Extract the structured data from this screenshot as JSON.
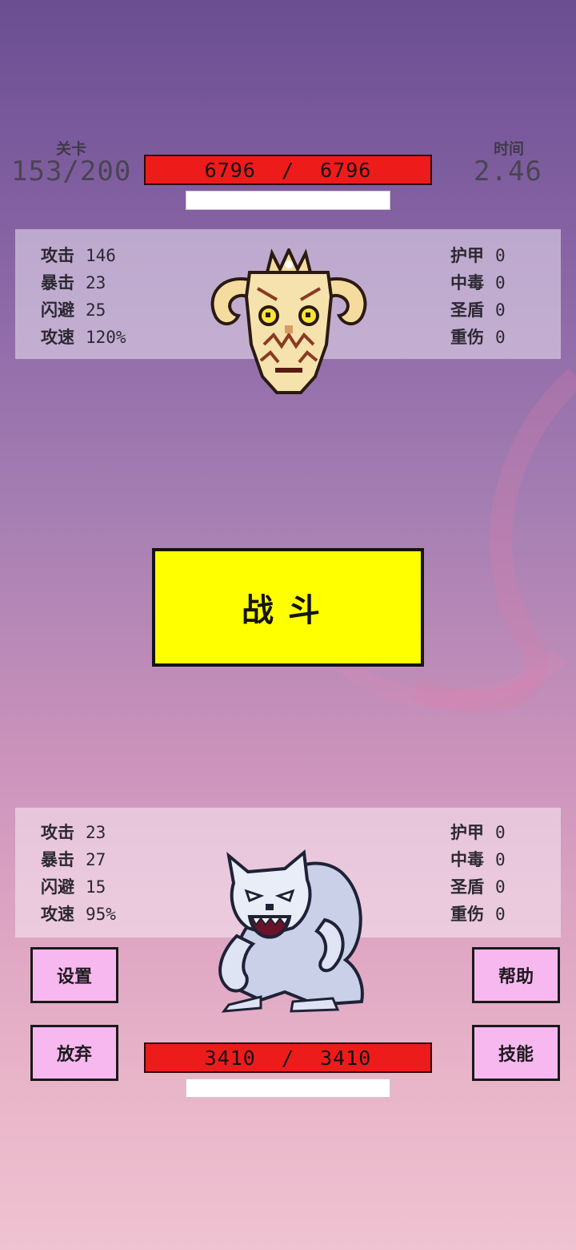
{
  "header": {
    "level_label": "关卡",
    "level_value": "153/200",
    "time_label": "时间",
    "time_value": "2.46"
  },
  "enemy": {
    "hp_text": "6796  /  6796",
    "sprite_icon": "horned-demon-mask-icon",
    "stats_left": [
      {
        "label": "攻击",
        "value": "146"
      },
      {
        "label": "暴击",
        "value": "23"
      },
      {
        "label": "闪避",
        "value": "25"
      },
      {
        "label": "攻速",
        "value": "120%"
      }
    ],
    "stats_right": [
      {
        "label": "护甲",
        "value": "0"
      },
      {
        "label": "中毒",
        "value": "0"
      },
      {
        "label": "圣盾",
        "value": "0"
      },
      {
        "label": "重伤",
        "value": "0"
      }
    ]
  },
  "fight_button": "战斗",
  "player": {
    "hp_text": "3410  /  3410",
    "sprite_icon": "white-werewolf-icon",
    "stats_left": [
      {
        "label": "攻击",
        "value": "23"
      },
      {
        "label": "暴击",
        "value": "27"
      },
      {
        "label": "闪避",
        "value": "15"
      },
      {
        "label": "攻速",
        "value": "95%"
      }
    ],
    "stats_right": [
      {
        "label": "护甲",
        "value": "0"
      },
      {
        "label": "中毒",
        "value": "0"
      },
      {
        "label": "圣盾",
        "value": "0"
      },
      {
        "label": "重伤",
        "value": "0"
      }
    ]
  },
  "buttons": {
    "settings": "设置",
    "help": "帮助",
    "give_up": "放弃",
    "skills": "技能"
  },
  "colors": {
    "hp_bar": "#ee1b1b",
    "fight_button": "#ffff00",
    "side_button": "#f7b8f0"
  }
}
